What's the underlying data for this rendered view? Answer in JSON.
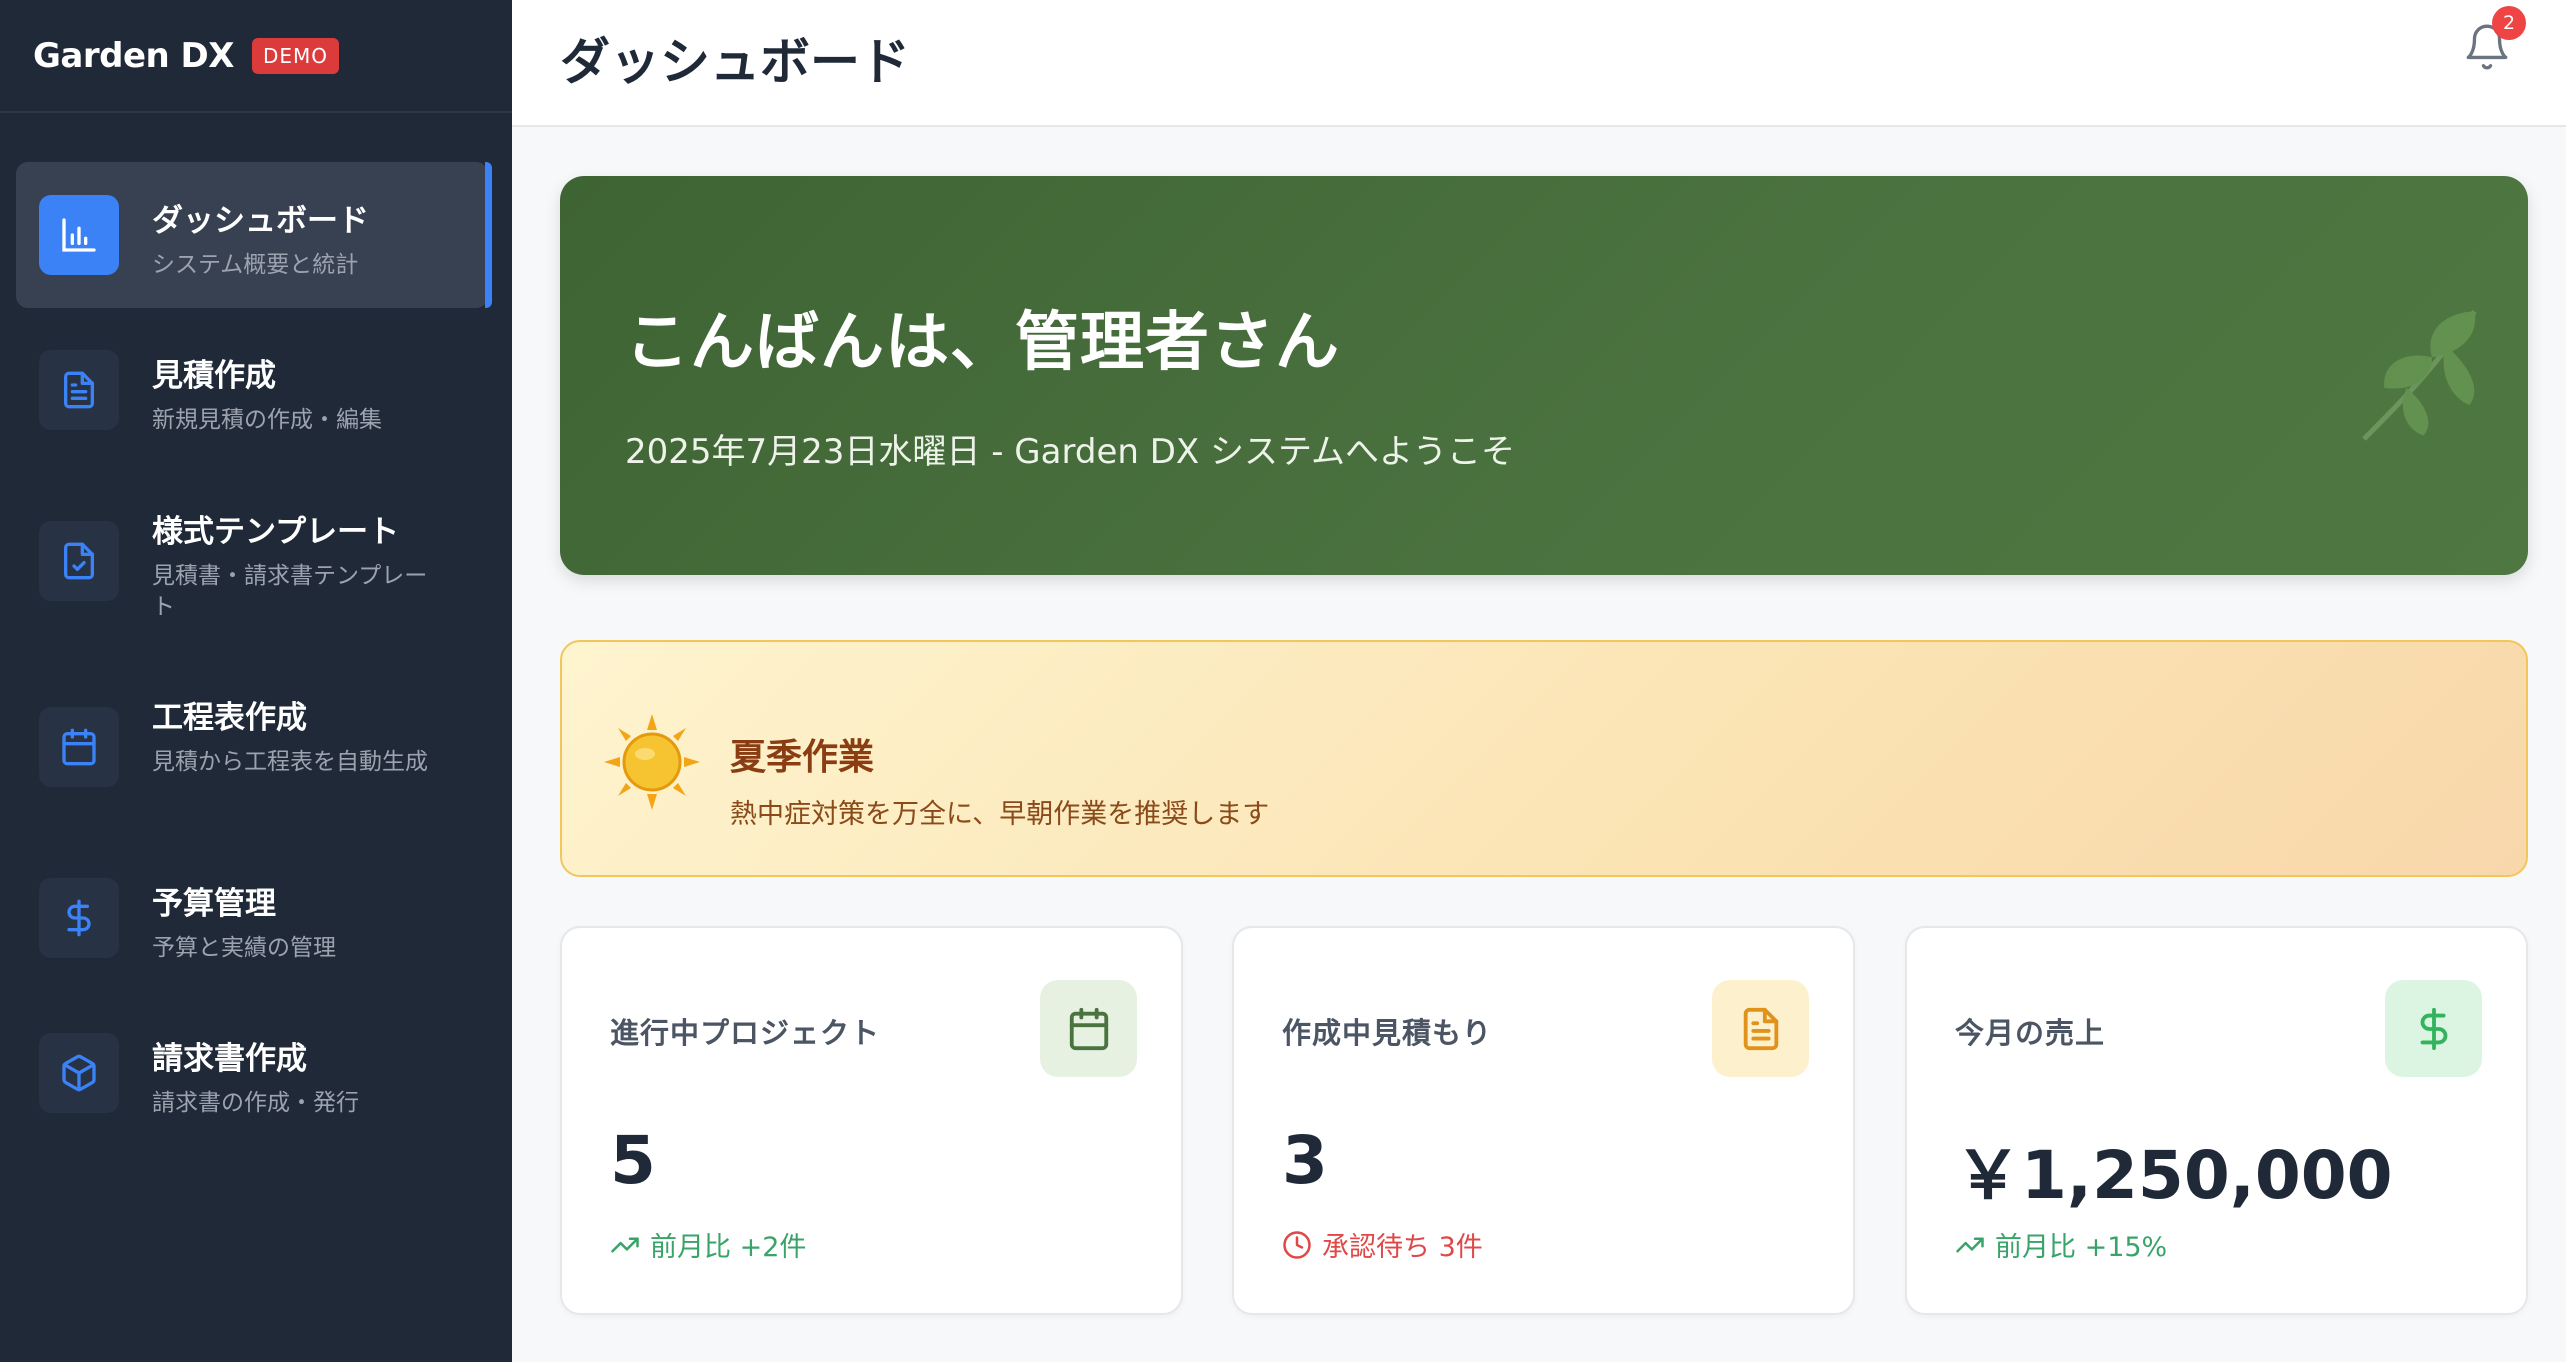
{
  "sidebar": {
    "brand": "Garden DX",
    "badge": "DEMO",
    "items": [
      {
        "label": "ダッシュボード",
        "sub": "システム概要と統計",
        "icon": "bar-chart-icon",
        "active": true
      },
      {
        "label": "見積作成",
        "sub": "新規見積の作成・編集",
        "icon": "document-icon"
      },
      {
        "label": "様式テンプレート",
        "sub": "見積書・請求書テンプレート",
        "icon": "document-check-icon"
      },
      {
        "label": "工程表作成",
        "sub": "見積から工程表を自動生成",
        "icon": "calendar-icon"
      },
      {
        "label": "予算管理",
        "sub": "予算と実績の管理",
        "icon": "dollar-icon"
      },
      {
        "label": "請求書作成",
        "sub": "請求書の作成・発行",
        "icon": "box-icon"
      }
    ]
  },
  "header": {
    "title": "ダッシュボード",
    "notification_count": "2"
  },
  "welcome": {
    "title": "こんばんは、管理者さん",
    "subtitle": "2025年7月23日水曜日 - Garden DX システムへようこそ"
  },
  "season": {
    "title": "夏季作業",
    "description": "熱中症対策を万全に、早朝作業を推奨します"
  },
  "stats": [
    {
      "label": "進行中プロジェクト",
      "value": "5",
      "foot": "前月比 +2件",
      "icon": "calendar-icon",
      "foot_color": "#3aa36a"
    },
    {
      "label": "作成中見積もり",
      "value": "3",
      "foot": "承認待ち 3件",
      "icon": "document-icon",
      "foot_color": "#e04848"
    },
    {
      "label": "今月の売上",
      "value": "￥1,250,000",
      "foot": "前月比 +15%",
      "icon": "dollar-icon",
      "foot_color": "#3aa36a"
    }
  ],
  "colors": {
    "sidebar_bg": "#1f2937",
    "accent": "#3b82f6",
    "welcome_green": "#4b7340",
    "positive": "#3aa36a",
    "warning": "#e04848"
  }
}
